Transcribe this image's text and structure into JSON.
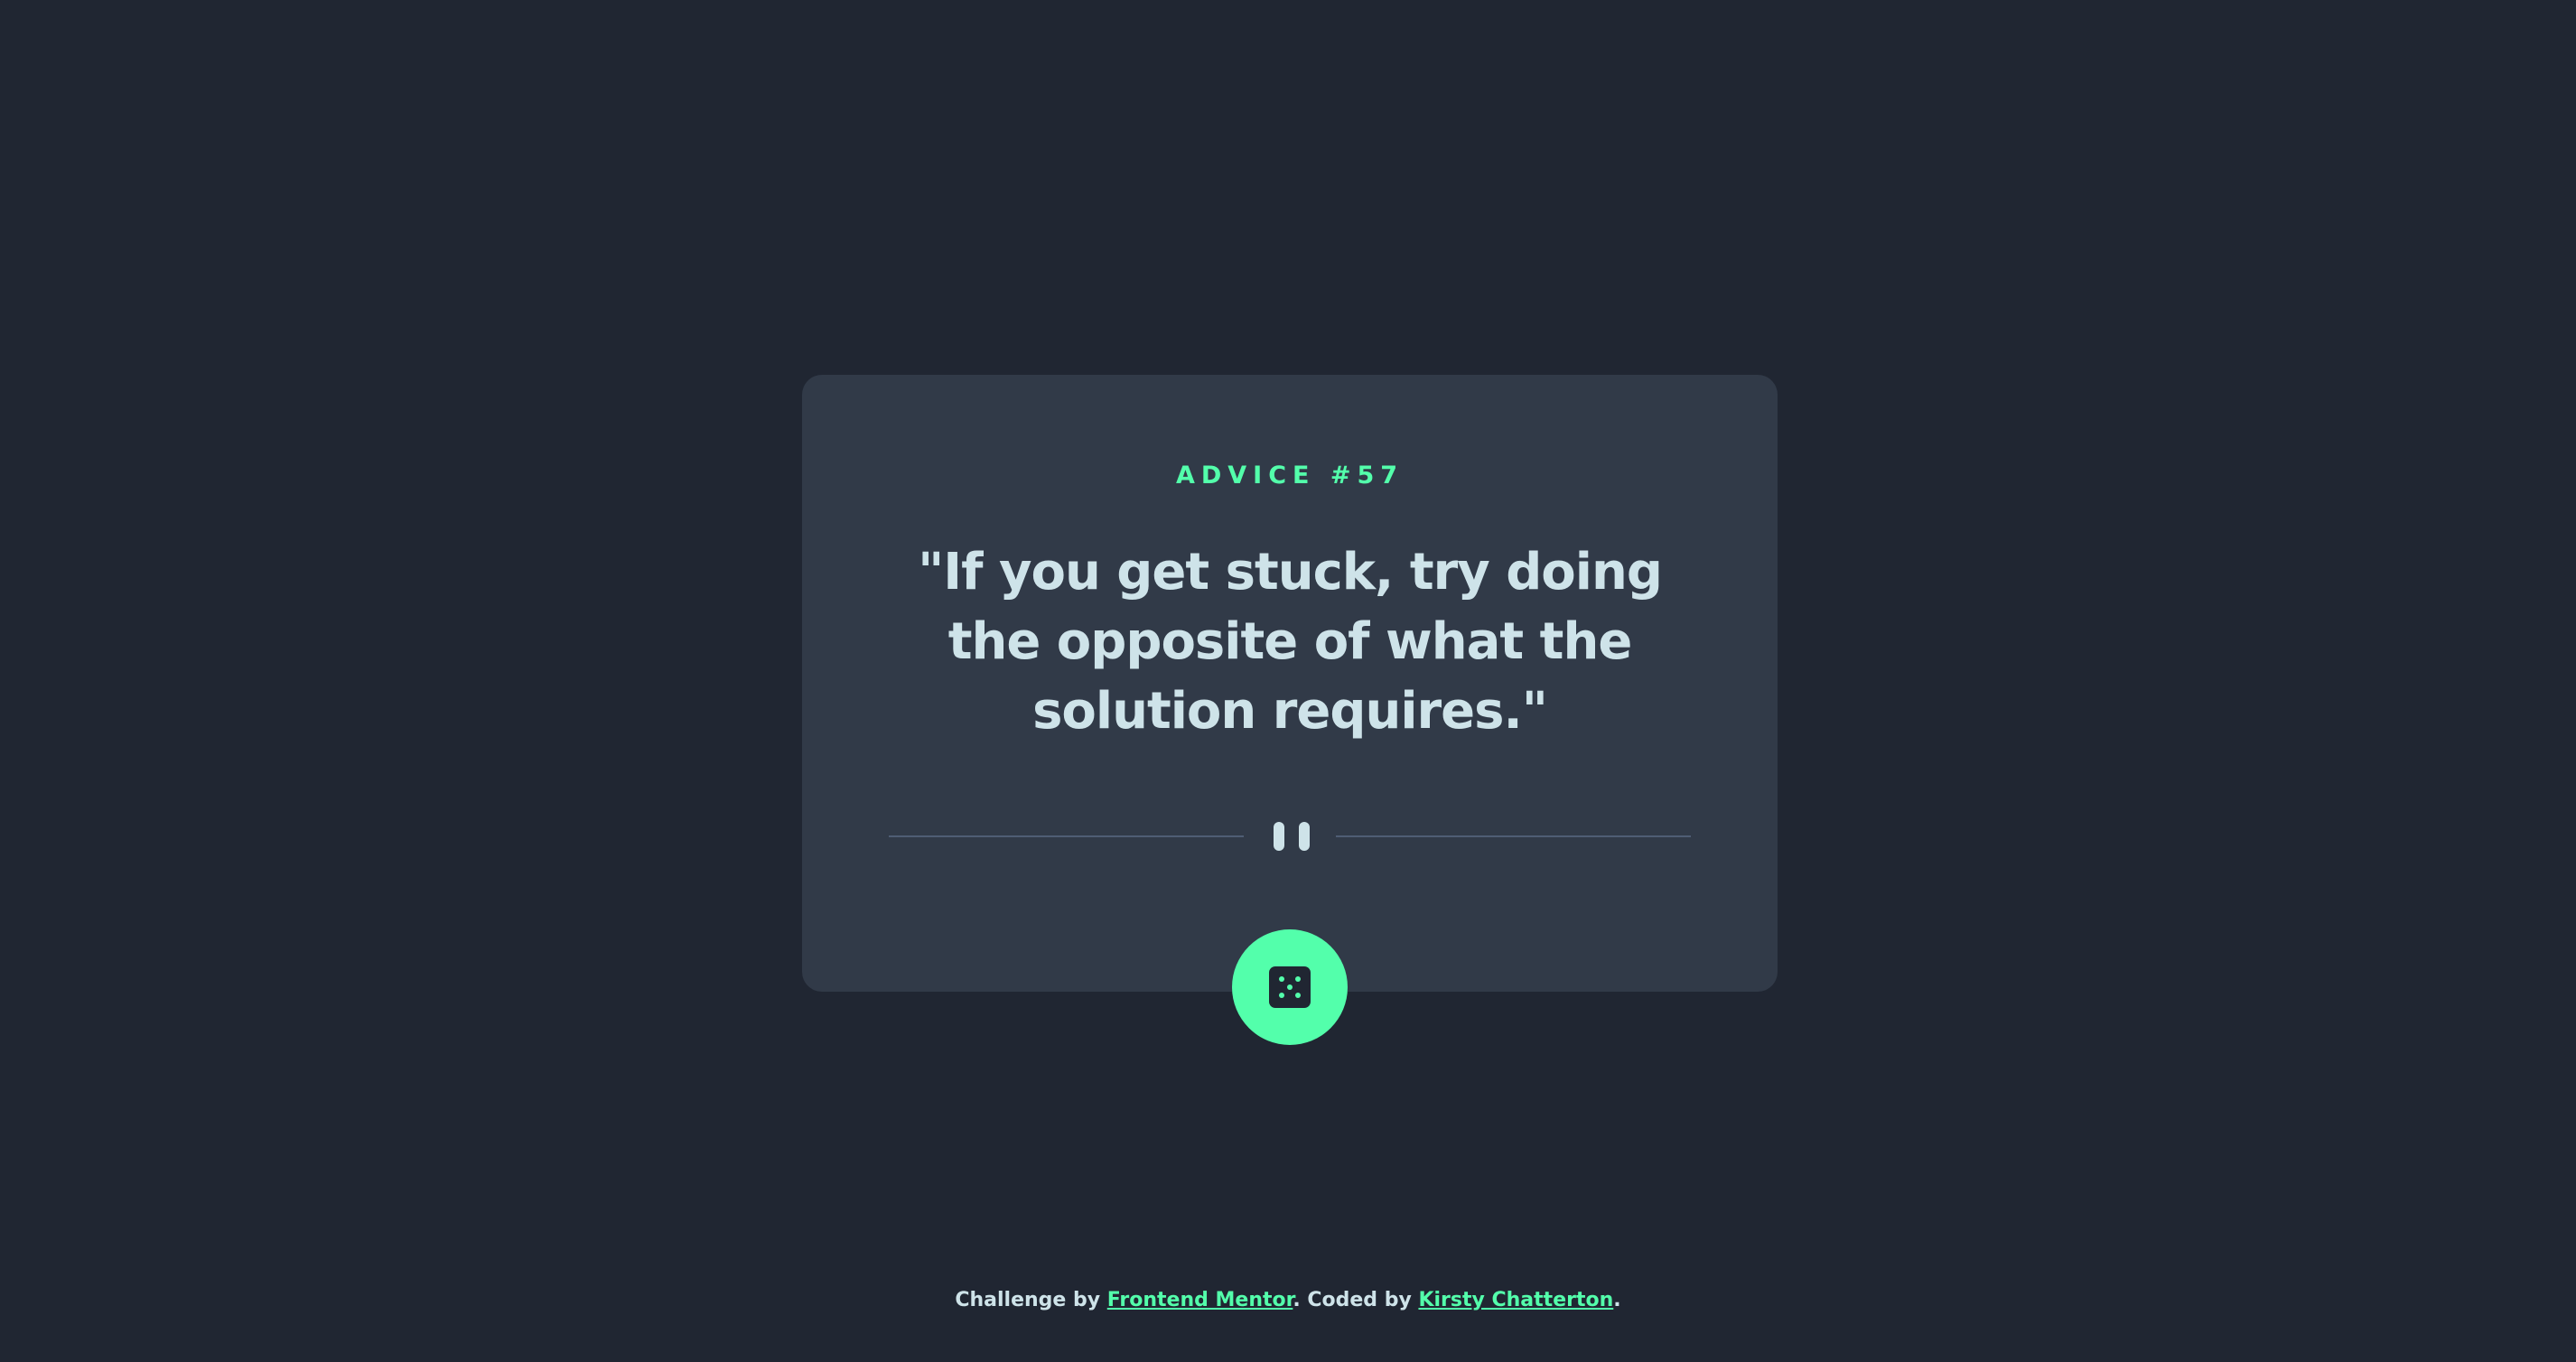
{
  "advice": {
    "label": "ADVICE #57",
    "quote": "\"If you get stuck, try doing the opposite of what the solution requires.\""
  },
  "divider": {
    "icon": "pause-icon"
  },
  "dice_button": {
    "icon": "dice-icon"
  },
  "footer": {
    "challenge_prefix": "Challenge by ",
    "challenge_link": "Frontend Mentor",
    "coded_prefix": ". Coded by ",
    "coded_link": "Kirsty Chatterton",
    "suffix": "."
  },
  "colors": {
    "background": "#202632",
    "card": "#313a48",
    "accent": "#53ffab",
    "text": "#cee3e9",
    "divider": "#4f5d74"
  }
}
